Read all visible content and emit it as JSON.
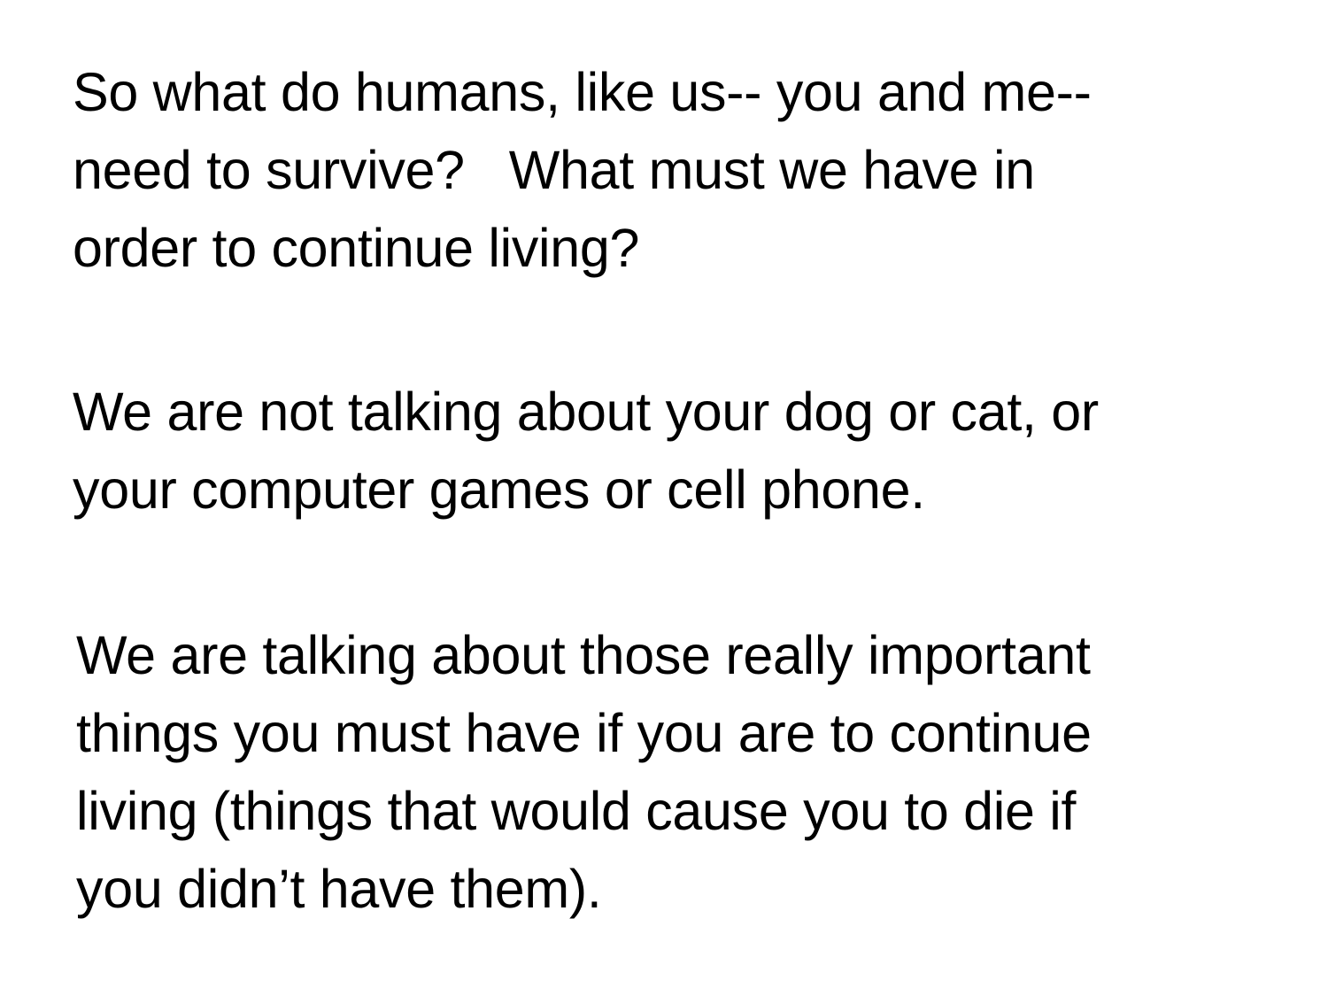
{
  "slide": {
    "paragraphs": [
      {
        "lines": [
          "So what do humans, like us-- you and me--",
          "need to survive?   What must we have in",
          "order to continue living?"
        ]
      },
      {
        "lines": [
          "We are not talking about your dog or cat, or",
          "your computer games or cell phone."
        ]
      },
      {
        "lines": [
          "We are talking about those really important",
          "things you must have if you are to continue",
          "living (things that would cause you to die if",
          "you didn’t have them)."
        ]
      }
    ]
  }
}
